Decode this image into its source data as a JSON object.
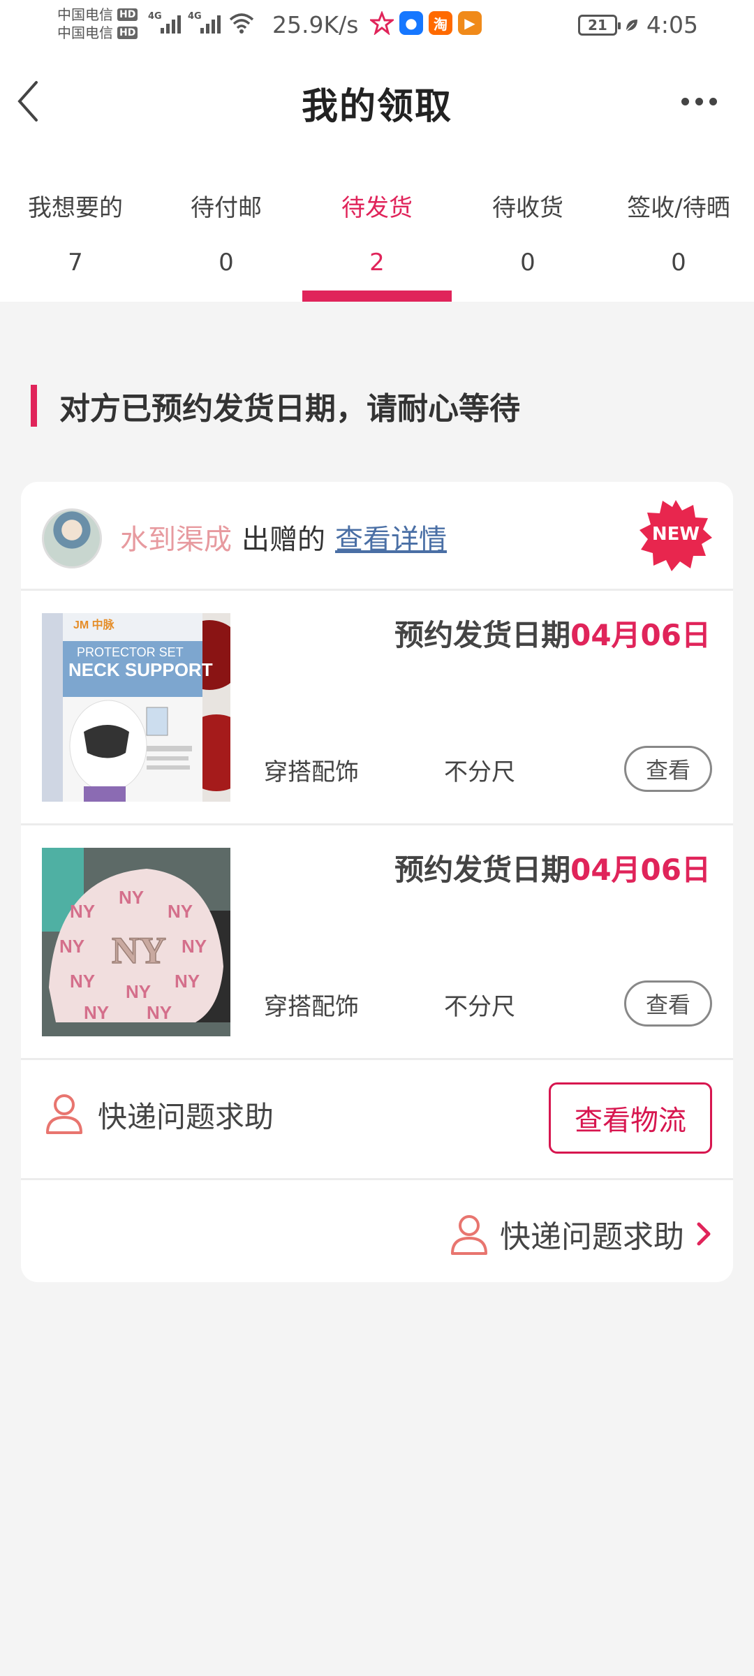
{
  "status_bar": {
    "carrier1": "中国电信",
    "carrier2": "中国电信",
    "hd": "HD",
    "network_label": "4G",
    "net_speed": "25.9K/s",
    "battery_level": "21",
    "time": "4:05",
    "app_icons": [
      "star-icon",
      "tencent-app-icon",
      "taobao-icon",
      "video-app-icon"
    ],
    "app_icon_text": {
      "taobao": "淘",
      "video": "▶"
    }
  },
  "header": {
    "title": "我的领取"
  },
  "tabs": [
    {
      "label": "我想要的",
      "count": "7"
    },
    {
      "label": "待付邮",
      "count": "0"
    },
    {
      "label": "待发货",
      "count": "2"
    },
    {
      "label": "待收货",
      "count": "0"
    },
    {
      "label": "签收/待晒",
      "count": "0"
    }
  ],
  "active_tab_index": 2,
  "notice": {
    "text": "对方已预约发货日期，请耐心等待"
  },
  "card": {
    "giver_name": "水到渠成",
    "giver_suffix": "出赠的",
    "detail_link": "查看详情",
    "new_badge": "NEW",
    "items": [
      {
        "ship_label": "预约发货日期",
        "ship_date": "04月06日",
        "category": "穿搭配饰",
        "size": "不分尺",
        "view_label": "查看",
        "image_text": {
          "brand": "JM 中脉",
          "line1": "PROTECTOR SET",
          "line2": "NECK SUPPORT"
        }
      },
      {
        "ship_label": "预约发货日期",
        "ship_date": "04月06日",
        "category": "穿搭配饰",
        "size": "不分尺",
        "view_label": "查看",
        "image_text": {
          "logo": "NY"
        }
      }
    ],
    "help_label": "快递问题求助",
    "logistics_button": "查看物流",
    "bottom_help_label": "快递问题求助"
  },
  "colors": {
    "accent": "#e0245a",
    "giver_name": "#e79a9f",
    "link": "#4a6fa5"
  }
}
